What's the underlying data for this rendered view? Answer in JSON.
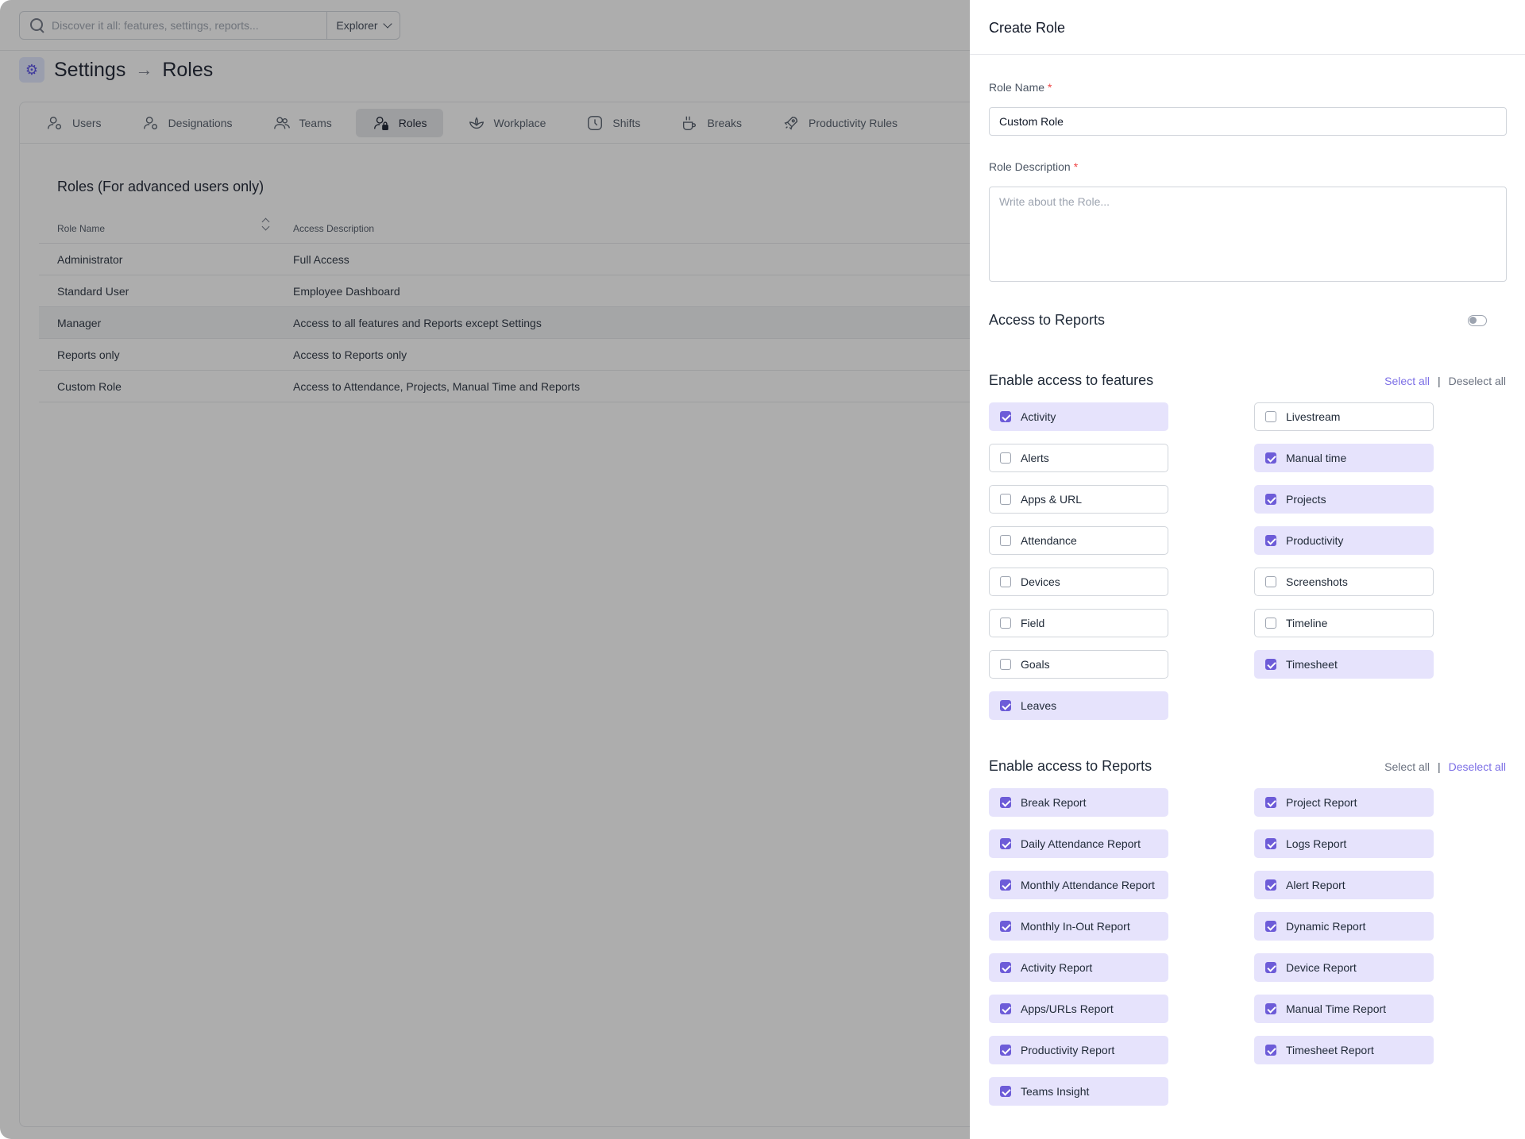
{
  "search": {
    "placeholder": "Discover it all: features, settings, reports...",
    "scope": "Explorer"
  },
  "breadcrumb": {
    "root": "Settings",
    "arrow": "→",
    "current": "Roles"
  },
  "tabs": [
    {
      "label": "Users",
      "icon": "user-gear-icon"
    },
    {
      "label": "Designations",
      "icon": "user-gear-icon"
    },
    {
      "label": "Teams",
      "icon": "users-icon"
    },
    {
      "label": "Roles",
      "icon": "user-lock-icon",
      "active": true
    },
    {
      "label": "Workplace",
      "icon": "lotus-icon"
    },
    {
      "label": "Shifts",
      "icon": "clock-icon"
    },
    {
      "label": "Breaks",
      "icon": "coffee-icon"
    },
    {
      "label": "Productivity Rules",
      "icon": "rocket-icon"
    }
  ],
  "roles": {
    "title": "Roles (For advanced users only)",
    "columns": [
      "Role Name",
      "Access Description"
    ],
    "rows": [
      [
        "Administrator",
        "Full Access"
      ],
      [
        "Standard User",
        "Employee Dashboard"
      ],
      [
        "Manager",
        "Access to all features and Reports except Settings"
      ],
      [
        "Reports only",
        "Access to Reports only"
      ],
      [
        "Custom Role",
        "Access to Attendance, Projects, Manual Time and Reports"
      ]
    ]
  },
  "drawer": {
    "title": "Create Role",
    "role_name_label": "Role Name",
    "role_name_value": "Custom Role",
    "role_desc_label": "Role Description",
    "role_desc_placeholder": "Write about the Role...",
    "required_mark": "*",
    "access_reports_label": "Access to Reports",
    "access_reports_on": false,
    "select_all": "Select all",
    "deselect_all": "Deselect all",
    "pipe": "|",
    "features_title": "Enable access to features",
    "features": [
      {
        "label": "Activity",
        "checked": true
      },
      {
        "label": "Livestream",
        "checked": false
      },
      {
        "label": "Alerts",
        "checked": false
      },
      {
        "label": "Manual time",
        "checked": true
      },
      {
        "label": "Apps & URL",
        "checked": false
      },
      {
        "label": "Projects",
        "checked": true
      },
      {
        "label": "Attendance",
        "checked": false
      },
      {
        "label": "Productivity",
        "checked": true
      },
      {
        "label": "Devices",
        "checked": false
      },
      {
        "label": "Screenshots",
        "checked": false
      },
      {
        "label": "Field",
        "checked": false
      },
      {
        "label": "Timeline",
        "checked": false
      },
      {
        "label": "Goals",
        "checked": false
      },
      {
        "label": "Timesheet",
        "checked": true
      },
      {
        "label": "Leaves",
        "checked": true
      }
    ],
    "reports_title": "Enable access to Reports",
    "reports": [
      {
        "label": "Break Report",
        "checked": true
      },
      {
        "label": "Project Report",
        "checked": true
      },
      {
        "label": "Daily Attendance Report",
        "checked": true
      },
      {
        "label": "Logs Report",
        "checked": true
      },
      {
        "label": "Monthly Attendance Report",
        "checked": true
      },
      {
        "label": "Alert Report",
        "checked": true
      },
      {
        "label": "Monthly In-Out Report",
        "checked": true
      },
      {
        "label": "Dynamic Report",
        "checked": true
      },
      {
        "label": "Activity Report",
        "checked": true
      },
      {
        "label": "Device Report",
        "checked": true
      },
      {
        "label": "Apps/URLs Report",
        "checked": true
      },
      {
        "label": "Manual Time Report",
        "checked": true
      },
      {
        "label": "Productivity Report",
        "checked": true
      },
      {
        "label": "Timesheet Report",
        "checked": true
      },
      {
        "label": "Teams Insight",
        "checked": true
      }
    ]
  },
  "colors": {
    "accent": "#6d5cd8",
    "checked_bg": "#e6e3fc",
    "link": "#7c6fe6",
    "required": "#ef4444"
  }
}
